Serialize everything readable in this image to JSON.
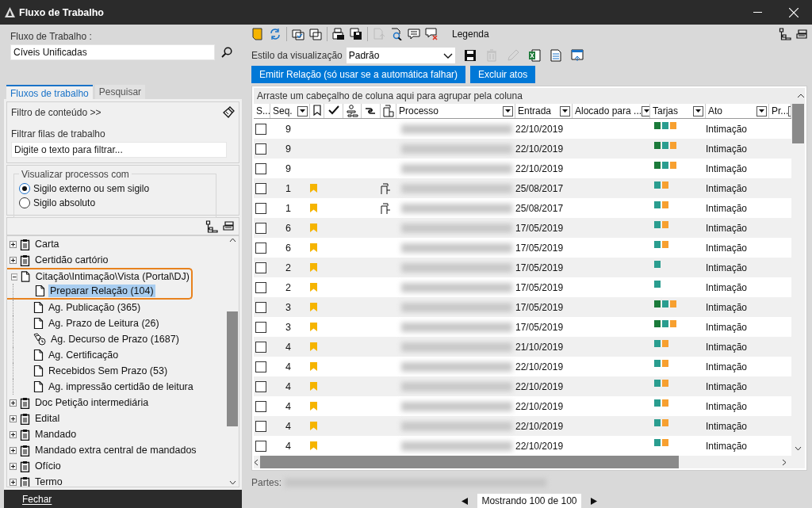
{
  "window": {
    "title": "Fluxo de Trabalho"
  },
  "workflow": {
    "label": "Fluxo de Trabalho :",
    "value": "Cíveis Unificadas"
  },
  "tabs": [
    {
      "label": "Fluxos de trabalho",
      "selected": true
    },
    {
      "label": "Pesquisar",
      "selected": false
    }
  ],
  "filter": {
    "toggle": "Filtro de conteúdo >>",
    "label": "Filtrar filas de trabalho",
    "placeholder": "Digite o texto para filtrar..."
  },
  "visibility": {
    "legend": "Visualizar processos com",
    "options": [
      {
        "label": "Sigilo externo ou sem sigilo",
        "selected": true
      },
      {
        "label": "Sigilo absoluto",
        "selected": false
      }
    ]
  },
  "tree": [
    {
      "label": "Carta",
      "kind": "folder",
      "expanded": false,
      "selected": false,
      "highlighted": false
    },
    {
      "label": "Certidão cartório",
      "kind": "folder",
      "expanded": false,
      "selected": false,
      "highlighted": false
    },
    {
      "label": "Citação\\Intimação\\Vista (Portal\\DJ)",
      "kind": "doc",
      "expanded": true,
      "selected": false,
      "highlighted": true,
      "children": [
        {
          "label": "Preparar Relação (104)",
          "kind": "doc",
          "selected": true,
          "highlighted": true
        },
        {
          "label": "Ag. Publicação (365)",
          "kind": "doc",
          "selected": false,
          "highlighted": false
        },
        {
          "label": "Ag. Prazo de Leitura (26)",
          "kind": "doc",
          "selected": false,
          "highlighted": false
        },
        {
          "label": "Ag. Decurso de Prazo (1687)",
          "kind": "clock",
          "selected": false,
          "highlighted": false
        },
        {
          "label": "Ag. Certificação",
          "kind": "doc",
          "selected": false,
          "highlighted": false
        },
        {
          "label": "Recebidos Sem Prazo (53)",
          "kind": "doc",
          "selected": false,
          "highlighted": false
        },
        {
          "label": "Ag. impressão certidão de leitura",
          "kind": "doc",
          "selected": false,
          "highlighted": false
        }
      ]
    },
    {
      "label": "Doc Petição intermediária",
      "kind": "folder",
      "expanded": false,
      "selected": false,
      "highlighted": false
    },
    {
      "label": "Edital",
      "kind": "folder",
      "expanded": false,
      "selected": false,
      "highlighted": false
    },
    {
      "label": "Mandado",
      "kind": "folder",
      "expanded": false,
      "selected": false,
      "highlighted": false
    },
    {
      "label": "Mandado extra central de mandados",
      "kind": "folder",
      "expanded": false,
      "selected": false,
      "highlighted": false
    },
    {
      "label": "Ofício",
      "kind": "folder",
      "expanded": false,
      "selected": false,
      "highlighted": false
    },
    {
      "label": "Termo",
      "kind": "folder",
      "expanded": false,
      "selected": false,
      "highlighted": false
    }
  ],
  "close_button": "Fechar",
  "toolbar": {
    "tools": [
      {
        "disabled": false
      },
      {
        "disabled": false
      },
      {
        "disabled": false
      },
      {
        "disabled": false
      },
      {
        "disabled": false
      },
      {
        "disabled": false
      },
      {
        "disabled": true
      },
      {
        "disabled": false
      },
      {
        "disabled": false
      },
      {
        "disabled": false
      }
    ],
    "legend": "Legenda"
  },
  "view_style": {
    "label": "Estilo da visualização",
    "value": "Padrão",
    "tools": [
      {
        "disabled": false
      },
      {
        "disabled": true
      },
      {
        "disabled": true
      },
      {
        "disabled": false
      },
      {
        "disabled": false
      },
      {
        "disabled": false
      }
    ]
  },
  "actions": [
    "Emitir Relação (só usar se a automática falhar)",
    "Excluir atos"
  ],
  "grid": {
    "group_hint": "Arraste um cabeçalho de coluna aqui para agrupar pela coluna",
    "columns": [
      {
        "kind": "text",
        "label": "S..."
      },
      {
        "kind": "text",
        "label": "Seq.",
        "filter": true
      },
      {
        "kind": "icon"
      },
      {
        "kind": "icon"
      },
      {
        "kind": "icon"
      },
      {
        "kind": "icon"
      },
      {
        "kind": "icon"
      },
      {
        "kind": "text",
        "label": "Processo",
        "filter": true
      },
      {
        "kind": "text",
        "label": "Entrada",
        "filter": true
      },
      {
        "kind": "text",
        "label": "Alocado para ...",
        "filter": true
      },
      {
        "kind": "text",
        "label": "Tarjas",
        "filter": true
      },
      {
        "kind": "text",
        "label": "Ato",
        "filter": true
      },
      {
        "kind": "text",
        "label": "Pr...",
        "filter": true
      }
    ],
    "rows": [
      {
        "checked": false,
        "seq": "9",
        "flagged": false,
        "attachment": false,
        "entrada": "22/10/2019",
        "tarjas": [
          {
            "color": "#1b7a3a"
          },
          {
            "color": "#2a9d8f"
          },
          {
            "color": "#f7a030"
          }
        ],
        "ato": "Intimação"
      },
      {
        "checked": false,
        "seq": "9",
        "flagged": false,
        "attachment": false,
        "entrada": "22/10/2019",
        "tarjas": [
          {
            "color": "#1b7a3a"
          },
          {
            "color": "#2a9d8f"
          },
          {
            "color": "#f7a030"
          }
        ],
        "ato": "Intimação"
      },
      {
        "checked": false,
        "seq": "9",
        "flagged": false,
        "attachment": false,
        "entrada": "22/10/2019",
        "tarjas": [
          {
            "color": "#1b7a3a"
          },
          {
            "color": "#2a9d8f"
          },
          {
            "color": "#f7a030"
          }
        ],
        "ato": "Intimação"
      },
      {
        "checked": false,
        "seq": "1",
        "flagged": true,
        "attachment": true,
        "entrada": "25/08/2017",
        "tarjas": [
          {
            "color": "#2a9d8f"
          },
          {
            "color": "#f7a030"
          }
        ],
        "ato": "Intimação"
      },
      {
        "checked": false,
        "seq": "1",
        "flagged": true,
        "attachment": true,
        "entrada": "25/08/2017",
        "tarjas": [
          {
            "color": "#2a9d8f"
          },
          {
            "color": "#f7a030"
          }
        ],
        "ato": "Intimação"
      },
      {
        "checked": false,
        "seq": "6",
        "flagged": true,
        "attachment": false,
        "entrada": "17/05/2019",
        "tarjas": [
          {
            "color": "#2a9d8f"
          },
          {
            "color": "#f7a030"
          }
        ],
        "ato": "Intimação"
      },
      {
        "checked": false,
        "seq": "6",
        "flagged": true,
        "attachment": false,
        "entrada": "17/05/2019",
        "tarjas": [
          {
            "color": "#2a9d8f"
          },
          {
            "color": "#f7a030"
          }
        ],
        "ato": "Intimação"
      },
      {
        "checked": false,
        "seq": "2",
        "flagged": true,
        "attachment": false,
        "entrada": "17/05/2019",
        "tarjas": [
          {
            "color": "#2a9d8f"
          }
        ],
        "ato": "Intimação"
      },
      {
        "checked": false,
        "seq": "2",
        "flagged": true,
        "attachment": false,
        "entrada": "17/05/2019",
        "tarjas": [
          {
            "color": "#2a9d8f"
          }
        ],
        "ato": "Intimação"
      },
      {
        "checked": false,
        "seq": "3",
        "flagged": true,
        "attachment": false,
        "entrada": "17/05/2019",
        "tarjas": [
          {
            "color": "#1b7a3a"
          },
          {
            "color": "#2a9d8f"
          },
          {
            "color": "#f7a030"
          }
        ],
        "ato": "Intimação"
      },
      {
        "checked": false,
        "seq": "3",
        "flagged": true,
        "attachment": false,
        "entrada": "17/05/2019",
        "tarjas": [
          {
            "color": "#1b7a3a"
          },
          {
            "color": "#2a9d8f"
          },
          {
            "color": "#f7a030"
          }
        ],
        "ato": "Intimação"
      },
      {
        "checked": false,
        "seq": "4",
        "flagged": true,
        "attachment": false,
        "entrada": "21/10/2019",
        "tarjas": [
          {
            "color": "#2a9d8f"
          },
          {
            "color": "#f7a030"
          }
        ],
        "ato": "Intimação"
      },
      {
        "checked": false,
        "seq": "4",
        "flagged": true,
        "attachment": false,
        "entrada": "22/10/2019",
        "tarjas": [
          {
            "color": "#2a9d8f"
          },
          {
            "color": "#f7a030"
          }
        ],
        "ato": "Intimação"
      },
      {
        "checked": false,
        "seq": "4",
        "flagged": true,
        "attachment": false,
        "entrada": "22/10/2019",
        "tarjas": [
          {
            "color": "#2a9d8f"
          },
          {
            "color": "#f7a030"
          }
        ],
        "ato": "Intimação"
      },
      {
        "checked": false,
        "seq": "4",
        "flagged": true,
        "attachment": false,
        "entrada": "22/10/2019",
        "tarjas": [
          {
            "color": "#2a9d8f"
          },
          {
            "color": "#f7a030"
          }
        ],
        "ato": "Intimação"
      },
      {
        "checked": false,
        "seq": "4",
        "flagged": true,
        "attachment": false,
        "entrada": "22/10/2019",
        "tarjas": [
          {
            "color": "#2a9d8f"
          },
          {
            "color": "#f7a030"
          }
        ],
        "ato": "Intimação"
      },
      {
        "checked": false,
        "seq": "4",
        "flagged": true,
        "attachment": false,
        "entrada": "22/10/2019",
        "tarjas": [
          {
            "color": "#2a9d8f"
          },
          {
            "color": "#f7a030"
          }
        ],
        "ato": "Intimação"
      }
    ]
  },
  "parts_label": "Partes:",
  "pager": "Mostrando 100 de 100"
}
